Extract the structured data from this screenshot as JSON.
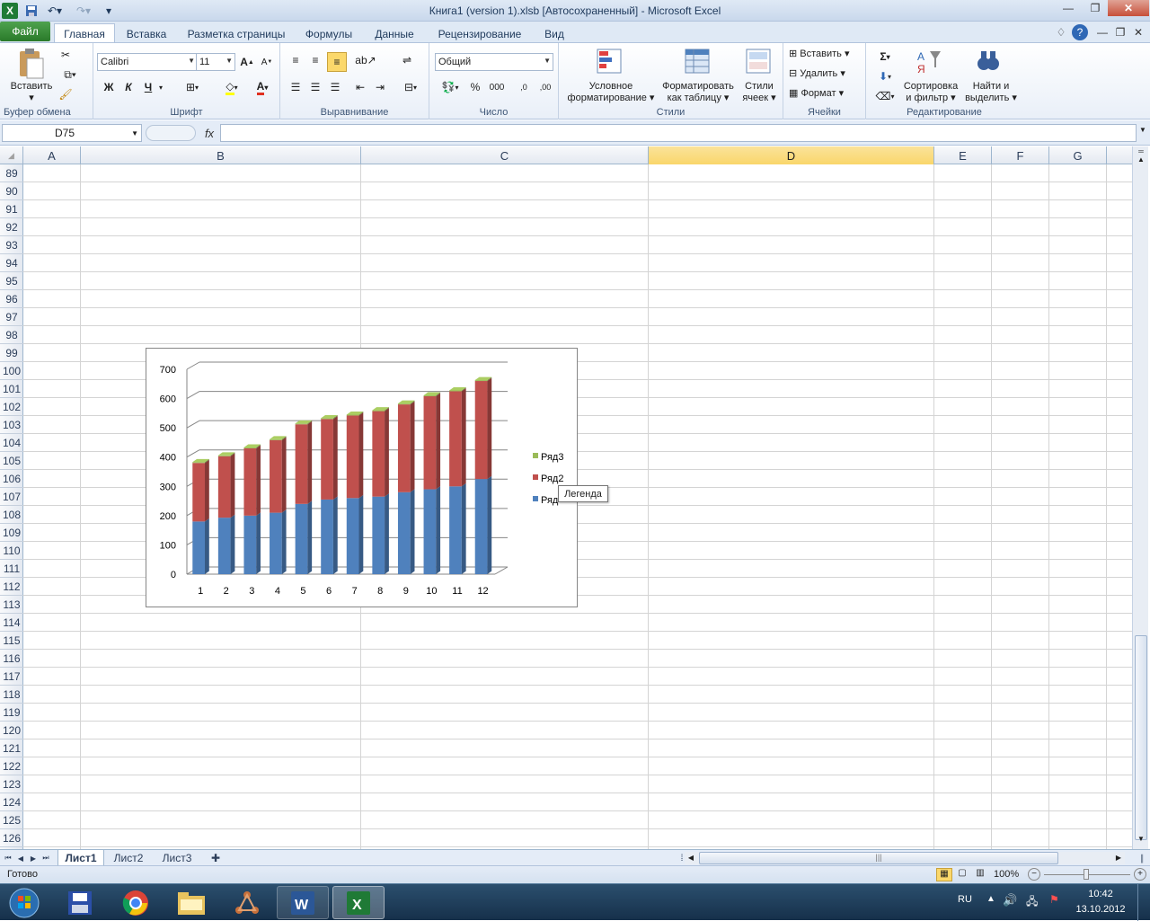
{
  "window": {
    "title": "Книга1 (version 1).xlsb [Автосохраненный]  -  Microsoft Excel"
  },
  "ribbon_tabs": {
    "file": "Файл",
    "tabs": [
      "Главная",
      "Вставка",
      "Разметка страницы",
      "Формулы",
      "Данные",
      "Рецензирование",
      "Вид"
    ],
    "active": "Главная"
  },
  "ribbon": {
    "clipboard": {
      "paste": "Вставить",
      "label": "Буфер обмена"
    },
    "font": {
      "name": "Calibri",
      "size": "11",
      "bold": "Ж",
      "italic": "К",
      "underline": "Ч",
      "label": "Шрифт"
    },
    "alignment": {
      "label": "Выравнивание"
    },
    "number": {
      "format": "Общий",
      "percent": "%",
      "thousands": "000",
      "inc": ",0",
      "dec": ",00",
      "label": "Число"
    },
    "styles": {
      "conditional_1": "Условное",
      "conditional_2": "форматирование",
      "table_1": "Форматировать",
      "table_2": "как таблицу",
      "cell_1": "Стили",
      "cell_2": "ячеек",
      "label": "Стили"
    },
    "cells": {
      "insert": "Вставить",
      "delete": "Удалить",
      "format": "Формат",
      "label": "Ячейки"
    },
    "editing": {
      "sum": "Σ",
      "sort_1": "Сортировка",
      "sort_2": "и фильтр",
      "find_1": "Найти и",
      "find_2": "выделить",
      "label": "Редактирование"
    }
  },
  "formula_bar": {
    "name_box": "D75",
    "fx": "fx",
    "formula": ""
  },
  "columns": [
    {
      "name": "A",
      "selected": false
    },
    {
      "name": "B",
      "selected": false
    },
    {
      "name": "C",
      "selected": false
    },
    {
      "name": "D",
      "selected": true
    },
    {
      "name": "E",
      "selected": false
    },
    {
      "name": "F",
      "selected": false
    },
    {
      "name": "G",
      "selected": false
    }
  ],
  "rows": [
    "89",
    "90",
    "91",
    "92",
    "93",
    "94",
    "95",
    "96",
    "97",
    "98",
    "99",
    "100",
    "101",
    "102",
    "103",
    "104",
    "105",
    "106",
    "107",
    "108",
    "109",
    "110",
    "111",
    "112",
    "113",
    "114",
    "115",
    "116",
    "117",
    "118",
    "119",
    "120",
    "121",
    "122",
    "123",
    "124",
    "125",
    "126"
  ],
  "chart_data": {
    "type": "bar",
    "stacked": true,
    "style": "3d-column",
    "categories": [
      "1",
      "2",
      "3",
      "4",
      "5",
      "6",
      "7",
      "8",
      "9",
      "10",
      "11",
      "12"
    ],
    "series": [
      {
        "name": "Ряд1",
        "color": "#4f81bd",
        "values": [
          180,
          193,
          200,
          210,
          240,
          255,
          260,
          265,
          280,
          290,
          300,
          325
        ]
      },
      {
        "name": "Ряд2",
        "color": "#c0504d",
        "values": [
          200,
          210,
          230,
          248,
          272,
          275,
          282,
          292,
          300,
          318,
          325,
          335
        ]
      },
      {
        "name": "Ряд3",
        "color": "#9bbb59",
        "values": [
          3,
          3,
          3,
          3,
          3,
          3,
          3,
          3,
          3,
          3,
          3,
          3
        ]
      }
    ],
    "ylim": [
      0,
      700
    ],
    "yticks": [
      "0",
      "100",
      "200",
      "300",
      "400",
      "500",
      "600",
      "700"
    ],
    "grid": true,
    "legend": "right",
    "legend_labels": [
      "Ряд3",
      "Ряд2",
      "Ряд"
    ],
    "tooltip": "Легенда"
  },
  "sheets": {
    "tabs": [
      "Лист1",
      "Лист2",
      "Лист3"
    ],
    "active": "Лист1"
  },
  "status": {
    "ready": "Готово",
    "zoom": "100%"
  },
  "taskbar": {
    "lang": "RU",
    "time": "10:42",
    "date": "13.10.2012"
  }
}
